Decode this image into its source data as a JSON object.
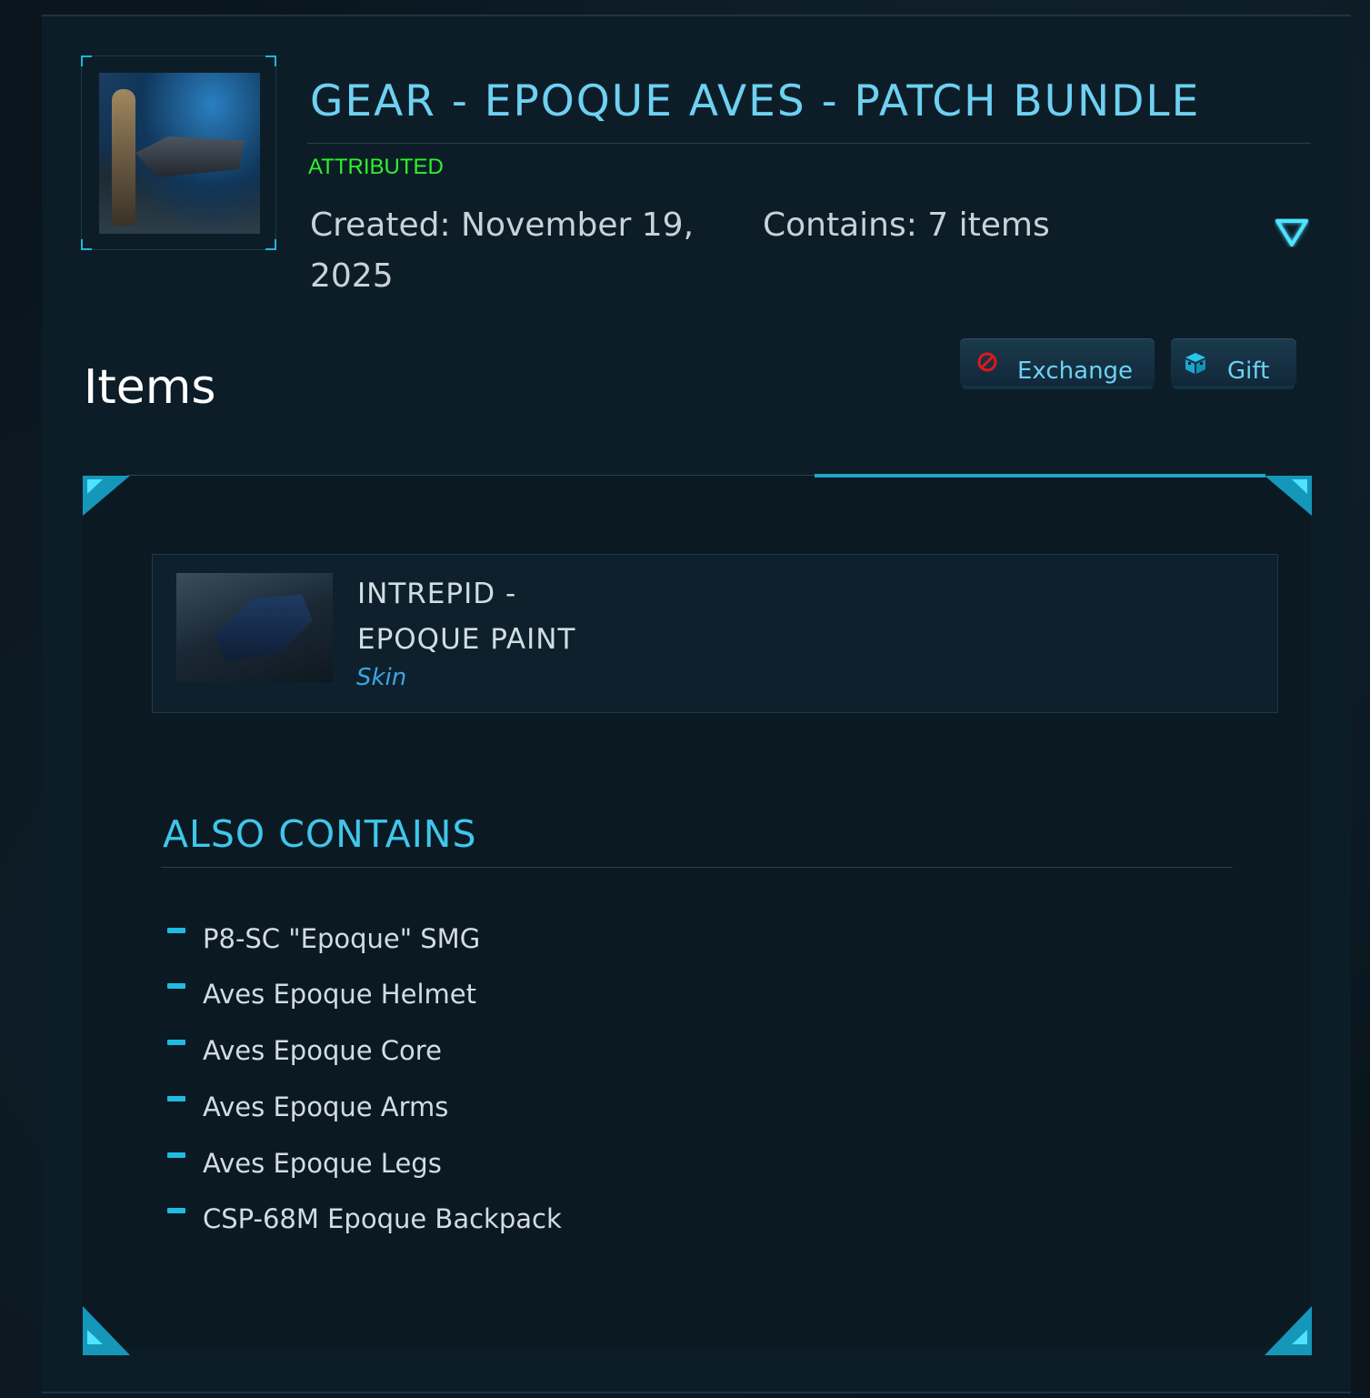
{
  "header": {
    "title": "GEAR - EPOQUE AVES - PATCH BUNDLE",
    "status": "ATTRIBUTED",
    "created_line1": "Created: November 19,",
    "created_line2": "2025",
    "contains": "Contains: 7 items",
    "thumbnail_icon": "bundle-thumbnail",
    "toggle_icon": "chevron-down-icon"
  },
  "items_section": {
    "heading": "Items",
    "buttons": {
      "exchange_label": "Exchange",
      "gift_label": "Gift"
    }
  },
  "item": {
    "name_line1": "INTREPID -",
    "name_line2": "EPOQUE PAINT",
    "type": "Skin"
  },
  "also_contains": {
    "heading": "ALSO CONTAINS",
    "items": [
      "P8-SC \"Epoque\" SMG",
      "Aves Epoque Helmet",
      "Aves Epoque Core",
      "Aves Epoque Arms",
      "Aves Epoque Legs",
      "CSP-68M Epoque Backpack"
    ]
  },
  "colors": {
    "accent": "#6ed1f2",
    "attributed": "#2ef22a",
    "heading": "#3fc7ea",
    "skin": "#3aa6e4",
    "exchange_icon": "#e01818"
  }
}
